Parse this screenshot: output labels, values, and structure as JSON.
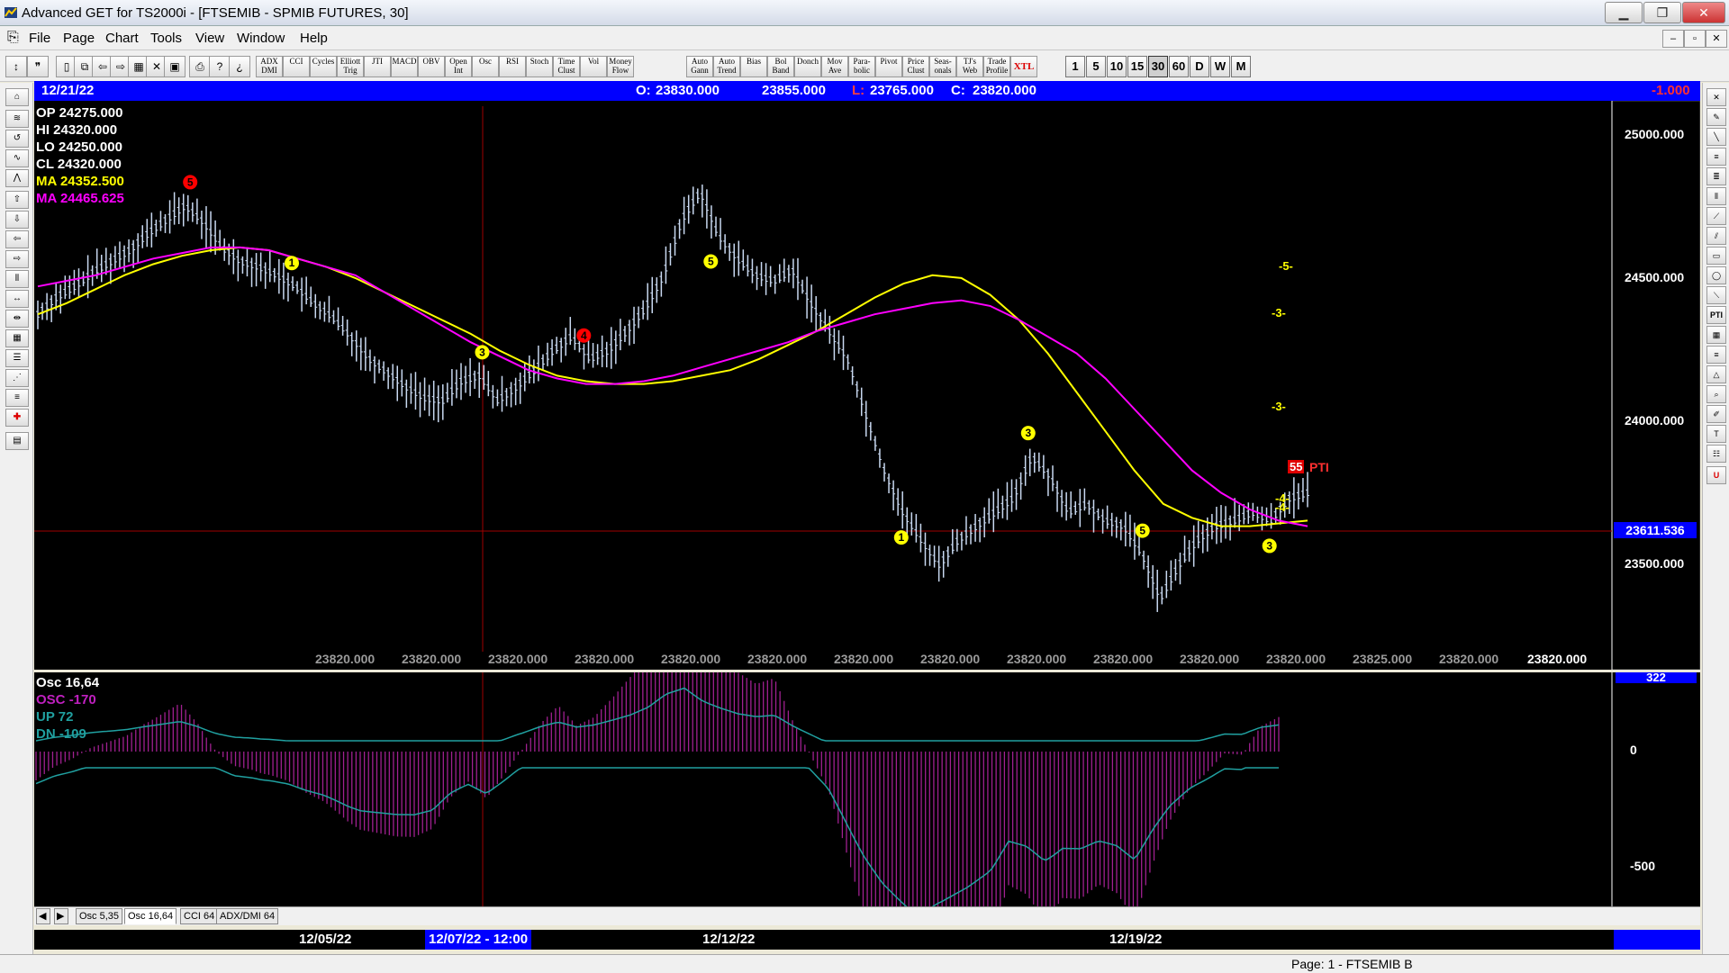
{
  "window": {
    "title": "Advanced GET for TS2000i - [FTSEMIB - SPMIB FUTURES, 30]",
    "min": "▁",
    "max": "❐",
    "close": "✕"
  },
  "menu": [
    "File",
    "Page",
    "Chart",
    "Tools",
    "View",
    "Window",
    "Help"
  ],
  "toolbar": {
    "studies": [
      "ADX DMI",
      "CCI",
      "Cycles",
      "Elliott Trig",
      "JTI",
      "MACD",
      "OBV",
      "Open Int",
      "Osc",
      "RSI",
      "Stoch",
      "Time Clust",
      "Vol",
      "Money Flow",
      "Auto Gann",
      "Auto Trend",
      "Bias",
      "Bol Band",
      "Donch",
      "Mov Ave",
      "Para- bolic",
      "Pivot",
      "Price Clust",
      "Seas- onals",
      "TJ's Web",
      "Trade Profile",
      "XTL"
    ],
    "timeframes": [
      "1",
      "5",
      "10",
      "15",
      "30",
      "60",
      "D",
      "W",
      "M"
    ],
    "active_timeframe": "30"
  },
  "infobar": {
    "date": "12/21/22",
    "open_label": "O:",
    "open": "23830.000",
    "high": "23855.000",
    "low_label": "L:",
    "low": "23765.000",
    "close_label": "C:",
    "close": "23820.000",
    "change": "-1.000"
  },
  "readout": [
    {
      "label": "OP",
      "value": "24275.000",
      "color": "#ffffff"
    },
    {
      "label": "HI",
      "value": "24320.000",
      "color": "#ffffff"
    },
    {
      "label": "LO",
      "value": "24250.000",
      "color": "#ffffff"
    },
    {
      "label": "CL",
      "value": "24320.000",
      "color": "#ffffff"
    },
    {
      "label": "MA",
      "value": "24352.500",
      "color": "#ffff00"
    },
    {
      "label": "MA",
      "value": "24465.625",
      "color": "#ff00ff"
    }
  ],
  "price_axis": [
    "25000.000",
    "24500.000",
    "24000.000",
    "23500.000"
  ],
  "current_price": "23611.536",
  "bottom_values": [
    "23820.000",
    "23820.000",
    "23820.000",
    "23820.000",
    "23820.000",
    "23820.000",
    "23820.000",
    "23820.000",
    "23820.000",
    "23820.000",
    "23820.000",
    "23820.000",
    "23825.000",
    "23820.000",
    "23820.000"
  ],
  "pti": {
    "value": "55",
    "label": "PTI"
  },
  "projections": [
    "-5-",
    "-3-",
    "-3-",
    "-4-",
    "-4-"
  ],
  "osc": {
    "title": "Osc 16,64",
    "lines": [
      {
        "label": "OSC",
        "value": "-170",
        "color": "#c020c0"
      },
      {
        "label": "UP",
        "value": "72",
        "color": "#20a0a0"
      },
      {
        "label": "DN",
        "value": "-109",
        "color": "#20a0a0"
      }
    ],
    "axis": [
      "322",
      "0",
      "-500"
    ]
  },
  "tabs": [
    "Osc 5,35",
    "Osc 16,64",
    "CCI 64",
    "ADX/DMI 64"
  ],
  "active_tab": "Osc 16,64",
  "dates": [
    "12/05/22",
    "12/07/22 - 12:00",
    "12/12/22",
    "12/19/22"
  ],
  "status": "Page: 1 - FTSEMIB B",
  "chart_data": {
    "type": "line",
    "title": "FTSEMIB - SPMIB FUTURES, 30",
    "ylim": [
      23250,
      25200
    ],
    "series": [
      {
        "values": [
          24460,
          24520,
          24560,
          24610,
          24650,
          24690,
          24750,
          24800,
          24850,
          24790,
          24700,
          24650,
          24630,
          24600,
          24560,
          24500,
          24450,
          24380,
          24300,
          24250,
          24200,
          24160,
          24150,
          24220,
          24240,
          24150,
          24200,
          24260,
          24330,
          24380,
          24300,
          24330,
          24400,
          24480,
          24600,
          24800,
          24900,
          24740,
          24660,
          24600,
          24580,
          24620,
          24500,
          24400,
          24300,
          24100,
          23900,
          23750,
          23650,
          23560,
          23650,
          23700,
          23750,
          23800,
          23950,
          23880,
          23750,
          23780,
          23720,
          23700,
          23600,
          23440,
          23560,
          23650,
          23700,
          23720,
          23750,
          23720,
          23800,
          23820
        ]
      },
      {
        "values": [
          24560,
          24580,
          24600,
          24630,
          24660,
          24680,
          24700,
          24700,
          24690,
          24660,
          24630,
          24600,
          24540,
          24480,
          24420,
          24360,
          24310,
          24260,
          24230,
          24210,
          24210,
          24220,
          24240,
          24270,
          24300,
          24330,
          24360,
          24400,
          24430,
          24460,
          24480,
          24500,
          24510,
          24490,
          24440,
          24380,
          24320,
          24230,
          24120,
          24010,
          23900,
          23820,
          23760,
          23720,
          23700
        ]
      },
      {
        "values": [
          24460,
          24500,
          24550,
          24600,
          24640,
          24670,
          24690,
          24700,
          24690,
          24660,
          24630,
          24590,
          24540,
          24490,
          24440,
          24390,
          24330,
          24280,
          24240,
          24220,
          24210,
          24210,
          24220,
          24240,
          24260,
          24300,
          24350,
          24400,
          24460,
          24520,
          24570,
          24600,
          24590,
          24530,
          24440,
          24320,
          24180,
          24040,
          23900,
          23780,
          23730,
          23700,
          23700,
          23710,
          23720
        ]
      }
    ]
  }
}
